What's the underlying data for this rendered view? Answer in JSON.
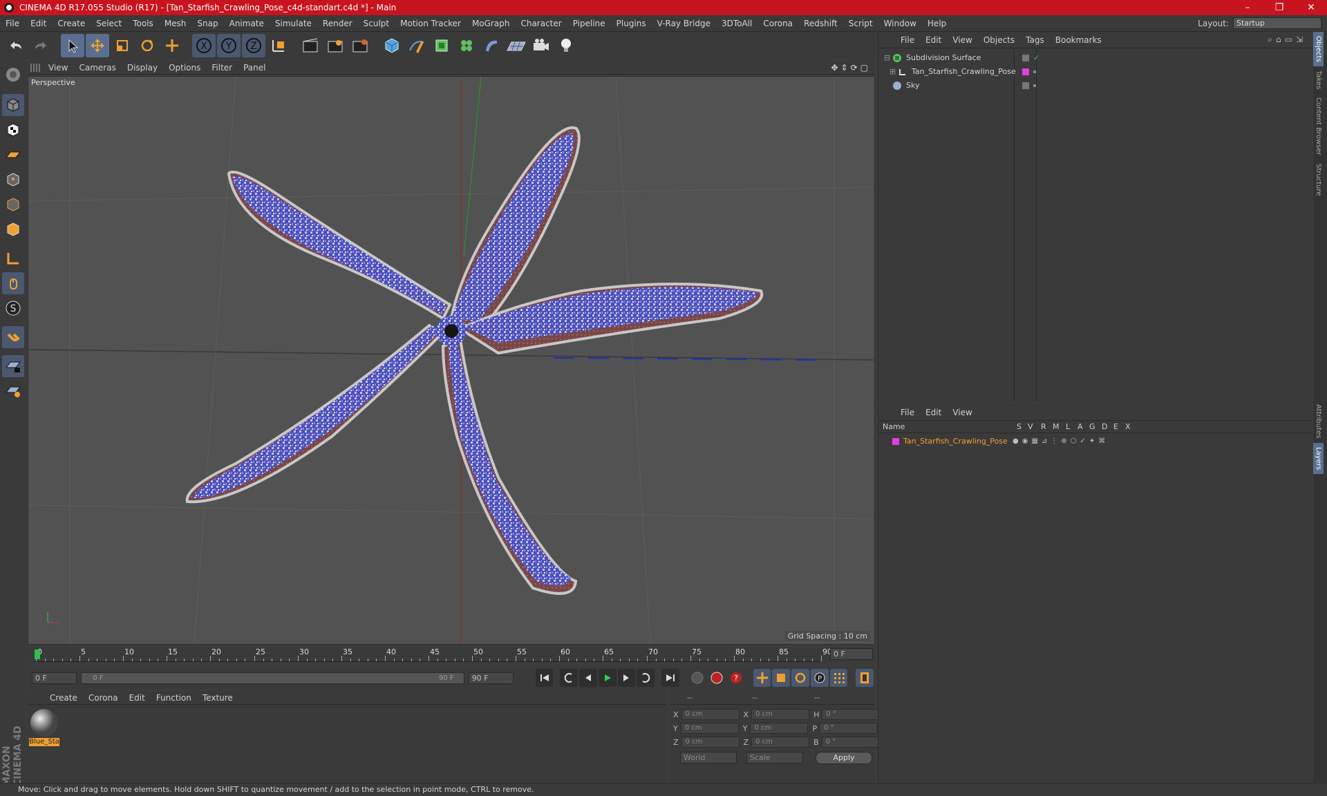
{
  "window": {
    "title": "CINEMA 4D R17.055 Studio (R17) - [Tan_Starfish_Crawling_Pose_c4d-standart.c4d *] - Main",
    "minimize": "–",
    "restore": "❐",
    "close": "✕"
  },
  "menu": [
    "File",
    "Edit",
    "Create",
    "Select",
    "Tools",
    "Mesh",
    "Snap",
    "Animate",
    "Simulate",
    "Render",
    "Sculpt",
    "Motion Tracker",
    "MoGraph",
    "Character",
    "Pipeline",
    "Plugins",
    "V-Ray Bridge",
    "3DToAll",
    "Corona",
    "Redshift",
    "Script",
    "Window",
    "Help"
  ],
  "layout": {
    "label": "Layout:",
    "value": "Startup"
  },
  "toolbar": {
    "icons": [
      "undo-icon",
      "redo-icon",
      "select-arrow-icon",
      "move-icon",
      "scale-icon",
      "rotate-icon",
      "transform-icon",
      "x-axis-icon",
      "y-axis-icon",
      "z-axis-icon",
      "coordinate-system-icon",
      "render-view-icon",
      "render-region-icon",
      "render-settings-icon",
      "cube-primitive-icon",
      "pen-spline-icon",
      "nurbs-icon",
      "mograph-cloner-icon",
      "deformer-icon",
      "floor-icon",
      "camera-icon",
      "light-icon"
    ],
    "axis_x": "X",
    "axis_y": "Y",
    "axis_z": "Z"
  },
  "viewport": {
    "menu": [
      "View",
      "Cameras",
      "Display",
      "Options",
      "Filter",
      "Panel"
    ],
    "label": "Perspective",
    "grid_spacing": "Grid Spacing : 10 cm"
  },
  "timeline": {
    "ticks": [
      "0",
      "5",
      "10",
      "15",
      "20",
      "25",
      "30",
      "35",
      "40",
      "45",
      "50",
      "55",
      "60",
      "65",
      "70",
      "75",
      "80",
      "85",
      "90"
    ],
    "current_frame": "0 F",
    "start_frame": "0 F",
    "range_start": "0 F",
    "range_end": "90 F",
    "end_frame": "90 F"
  },
  "material": {
    "menu": [
      "Create",
      "Corona",
      "Edit",
      "Function",
      "Texture"
    ],
    "name": "Blue_Sta"
  },
  "coords": {
    "header_left": "--",
    "header_mid": "--",
    "header_right": "--",
    "rows": [
      {
        "a": "X",
        "av": "0 cm",
        "b": "X",
        "bv": "0 cm",
        "c": "H",
        "cv": "0 °"
      },
      {
        "a": "Y",
        "av": "0 cm",
        "b": "Y",
        "bv": "0 cm",
        "c": "P",
        "cv": "0 °"
      },
      {
        "a": "Z",
        "av": "0 cm",
        "b": "Z",
        "bv": "0 cm",
        "c": "B",
        "cv": "0 °"
      }
    ],
    "mode1": "World",
    "mode2": "Scale",
    "apply": "Apply"
  },
  "objects": {
    "menu": [
      "File",
      "Edit",
      "View",
      "Objects",
      "Tags",
      "Bookmarks"
    ],
    "items": [
      {
        "name": "Subdivision Surface"
      },
      {
        "name": "Tan_Starfish_Crawling_Pose"
      },
      {
        "name": "Sky"
      }
    ]
  },
  "layers": {
    "menu": [
      "File",
      "Edit",
      "View"
    ],
    "columns": [
      "Name",
      "S",
      "V",
      "R",
      "M",
      "L",
      "A",
      "G",
      "D",
      "E",
      "X"
    ],
    "items": [
      {
        "name": "Tan_Starfish_Crawling_Pose",
        "color": "#e040e0"
      }
    ]
  },
  "sidetabs": [
    "Objects",
    "Takes",
    "Content Browser",
    "Structure",
    "Attributes",
    "Layers"
  ],
  "brand": "MAXON CINEMA 4D",
  "status": "Move: Click and drag to move elements. Hold down SHIFT to quantize movement / add to the selection in point mode, CTRL to remove.",
  "colors": {
    "title_bar": "#c8141e",
    "accent": "#f0a030",
    "selected": "#5a6f8f",
    "layer": "#e040e0"
  }
}
